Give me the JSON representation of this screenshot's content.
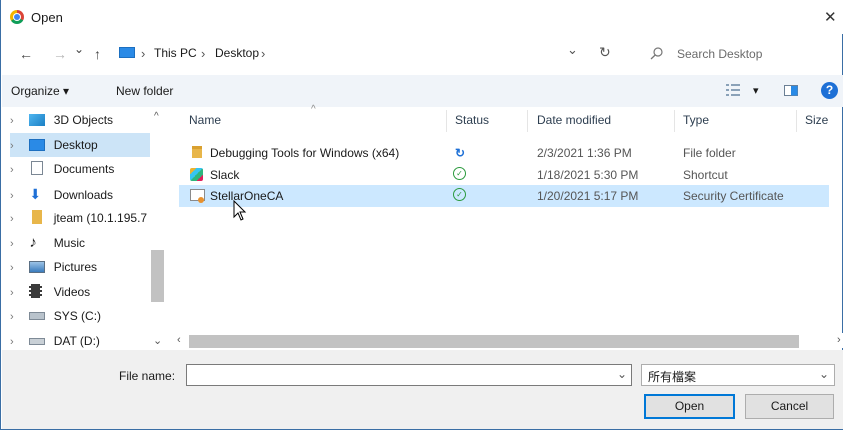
{
  "window": {
    "title": "Open",
    "close_glyph": "✕"
  },
  "address_bar": {
    "back_glyph": "←",
    "forward_glyph": "→",
    "recent_glyph": "⌄",
    "up_glyph": "↑",
    "crumbs": [
      {
        "label": "This PC"
      },
      {
        "label": "Desktop"
      }
    ],
    "sep_glyph": "›",
    "dropdown_glyph": "⌄",
    "refresh_glyph": "↻",
    "search_placeholder": "Search Desktop"
  },
  "toolbar": {
    "organize_label": "Organize ▾",
    "new_folder_label": "New folder",
    "view_glyph": "▾",
    "help_glyph": "?"
  },
  "nav_pane": {
    "items": [
      {
        "label": "3D Objects",
        "icon": "3d-objects-icon"
      },
      {
        "label": "Desktop",
        "icon": "desktop-icon"
      },
      {
        "label": "Documents",
        "icon": "documents-icon"
      },
      {
        "label": "Downloads",
        "icon": "downloads-icon"
      },
      {
        "label": "jteam (10.1.195.7",
        "icon": "network-drive-icon"
      },
      {
        "label": "Music",
        "icon": "music-icon"
      },
      {
        "label": "Pictures",
        "icon": "pictures-icon"
      },
      {
        "label": "Videos",
        "icon": "videos-icon"
      },
      {
        "label": "SYS (C:)",
        "icon": "drive-icon"
      },
      {
        "label": "DAT (D:)",
        "icon": "drive-icon"
      }
    ]
  },
  "file_list": {
    "columns": {
      "name": "Name",
      "status": "Status",
      "date": "Date modified",
      "type": "Type",
      "size": "Size"
    },
    "rows": [
      {
        "name": "Debugging Tools for Windows (x64)",
        "status": "sync-icon",
        "status_glyph": "↻",
        "date": "2/3/2021 1:36 PM",
        "type": "File folder",
        "icon": "folder-icon"
      },
      {
        "name": "Slack",
        "status": "available-icon",
        "status_glyph": "✓",
        "date": "1/18/2021 5:30 PM",
        "type": "Shortcut",
        "icon": "shortcut-icon"
      },
      {
        "name": "StellarOneCA",
        "status": "available-icon",
        "status_glyph": "✓",
        "date": "1/20/2021 5:17 PM",
        "type": "Security Certificate",
        "icon": "certificate-icon"
      }
    ],
    "selected_index": 2
  },
  "footer": {
    "file_name_label": "File name:",
    "file_name_value": "",
    "file_type_value": "所有檔案",
    "open_label": "Open",
    "cancel_label": "Cancel"
  },
  "colors": {
    "accent": "#0078d7",
    "selection": "#cce8ff",
    "toolbar_bg": "#f0f4f9",
    "status_green": "#2b9a3e"
  }
}
